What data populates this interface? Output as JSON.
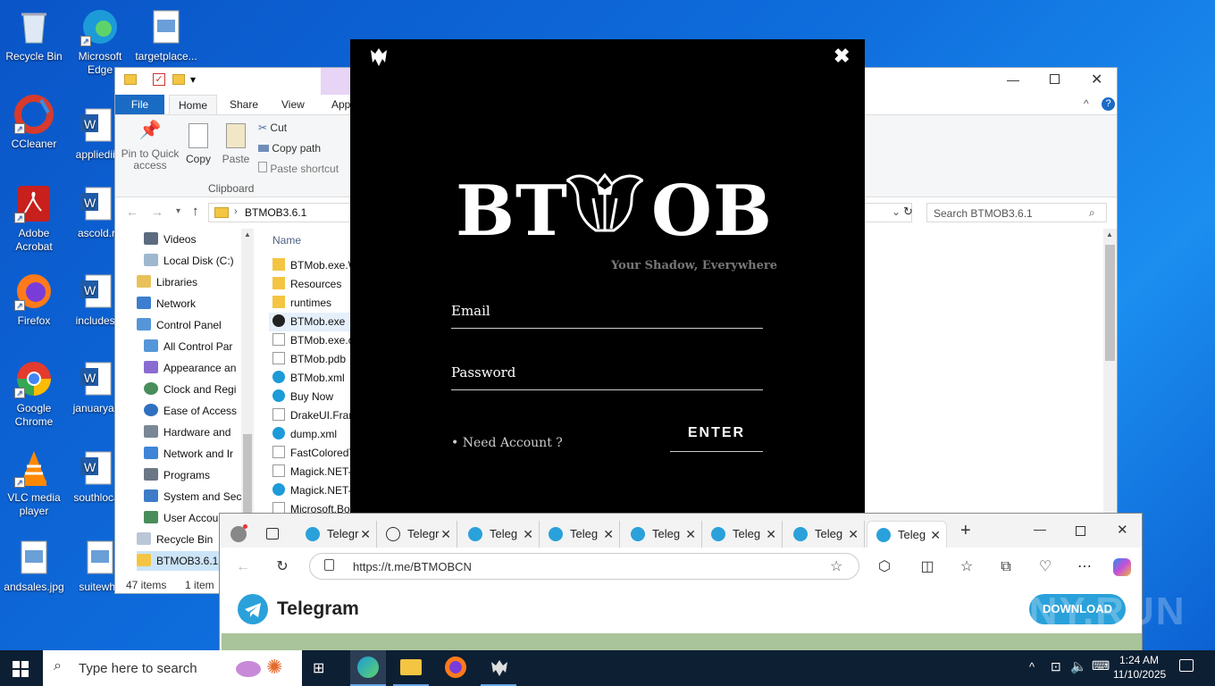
{
  "desktop": {
    "icons": [
      {
        "label": "Recycle Bin"
      },
      {
        "label": "Microsoft Edge"
      },
      {
        "label": "targetplace..."
      },
      {
        "label": "CCleaner"
      },
      {
        "label": "appliediii"
      },
      {
        "label": "Adobe Acrobat"
      },
      {
        "label": "ascold.r"
      },
      {
        "label": "Firefox"
      },
      {
        "label": "includesj"
      },
      {
        "label": "Google Chrome"
      },
      {
        "label": "januaryab"
      },
      {
        "label": "VLC media player"
      },
      {
        "label": "southloca"
      },
      {
        "label": "andsales.jpg"
      },
      {
        "label": "suitewho"
      }
    ]
  },
  "explorer": {
    "menu": {
      "file": "File",
      "home": "Home",
      "share": "Share",
      "view": "View",
      "app": "App"
    },
    "ribbon": {
      "pin": "Pin to Quick access",
      "copy": "Copy",
      "paste": "Paste",
      "cut": "Cut",
      "copy_path": "Copy path",
      "paste_shortcut": "Paste shortcut",
      "group": "Clipboard"
    },
    "breadcrumb": "BTMOB3.6.1",
    "search_placeholder": "Search BTMOB3.6.1",
    "column_name": "Name",
    "tree": [
      "Videos",
      "Local Disk (C:)",
      "Libraries",
      "Network",
      "Control Panel",
      "All Control Par",
      "Appearance an",
      "Clock and Regi",
      "Ease of Access",
      "Hardware and",
      "Network and Ir",
      "Programs",
      "System and Sec",
      "User Accou",
      "Recycle Bin",
      "BTMOB3.6.1"
    ],
    "files": [
      "BTMob.exe.W",
      "Resources",
      "runtimes",
      "BTMob.exe",
      "BTMob.exe.c",
      "BTMob.pdb",
      "BTMob.xml",
      "Buy Now",
      "DrakeUI.Fran",
      "dump.xml",
      "FastColoredT",
      "Magick.NET-",
      "Magick.NET-",
      "Microsoft.Bo"
    ],
    "status_items": "47 items",
    "status_selected": "1 item"
  },
  "btmob": {
    "logo_left": "BT",
    "logo_right": "OB",
    "tagline": "Your Shadow, Everywhere",
    "email_label": "Email",
    "password_label": "Password",
    "need_account": "• Need Account ?",
    "enter": "ENTER",
    "close": "✖"
  },
  "edge": {
    "tabs": [
      {
        "label": "Telegr"
      },
      {
        "label": "Telegr"
      },
      {
        "label": "Teleg"
      },
      {
        "label": "Teleg"
      },
      {
        "label": "Teleg"
      },
      {
        "label": "Teleg"
      },
      {
        "label": "Teleg"
      },
      {
        "label": "Teleg"
      }
    ],
    "url": "https://t.me/BTMOBCN",
    "page_title": "Telegram",
    "download": "DOWNLOAD"
  },
  "taskbar": {
    "search_placeholder": "Type here to search",
    "time": "1:24 AM",
    "date": "11/10/2025"
  },
  "watermark": "ANY.RUN"
}
